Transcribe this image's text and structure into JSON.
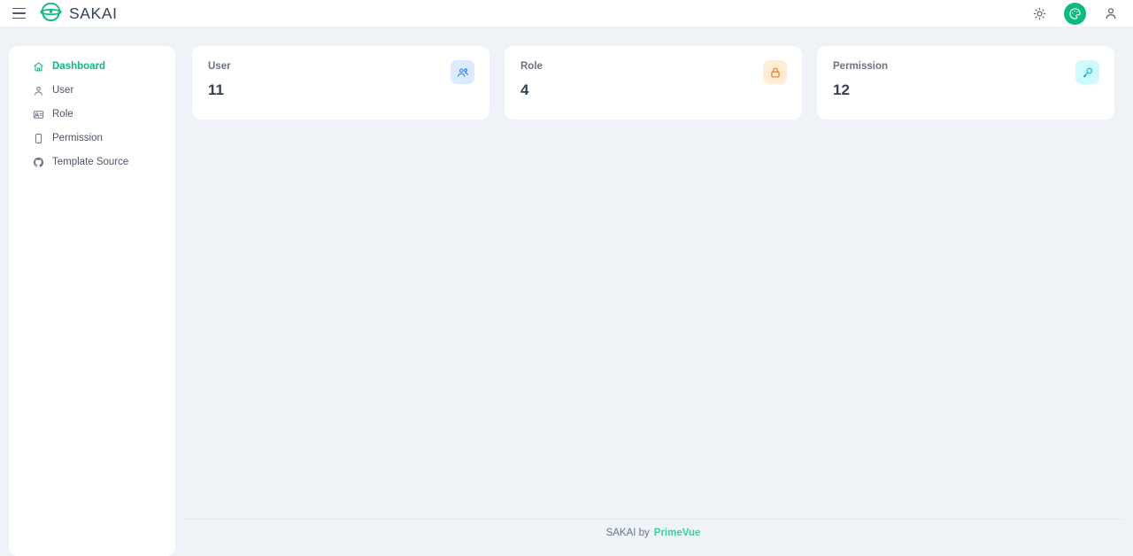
{
  "app": {
    "name": "SAKAI",
    "accent_color": "#10b981",
    "background_color": "#eff3f8",
    "surface_color": "#ffffff"
  },
  "topbar": {
    "menu_button_label": "Menu",
    "logo_text": "SAKAI",
    "icons": [
      {
        "name": "sun-icon",
        "label": "Light mode"
      },
      {
        "name": "palette-icon",
        "label": "Theme configurator"
      },
      {
        "name": "user-icon",
        "label": "Profile"
      }
    ]
  },
  "sidebar": {
    "items": [
      {
        "label": "Dashboard",
        "icon": "home-icon",
        "active": true
      },
      {
        "label": "User",
        "icon": "user-icon",
        "active": false
      },
      {
        "label": "Role",
        "icon": "id-card-icon",
        "active": false
      },
      {
        "label": "Permission",
        "icon": "mobile-icon",
        "active": false
      },
      {
        "label": "Template Source",
        "icon": "github-icon",
        "active": false
      }
    ]
  },
  "main": {
    "cards": [
      {
        "label": "User",
        "value": "11",
        "icon": "users-icon",
        "icon_color": "#3b82f6",
        "icon_bg": "#dbeafe"
      },
      {
        "label": "Role",
        "value": "4",
        "icon": "lock-icon",
        "icon_color": "#f97316",
        "icon_bg": "#ffedd5"
      },
      {
        "label": "Permission",
        "value": "12",
        "icon": "key-icon",
        "icon_color": "#06b6d4",
        "icon_bg": "#cffafe"
      }
    ]
  },
  "footer": {
    "text": "SAKAI by",
    "brand": "PrimeVue",
    "brand_color": "#34d399"
  }
}
